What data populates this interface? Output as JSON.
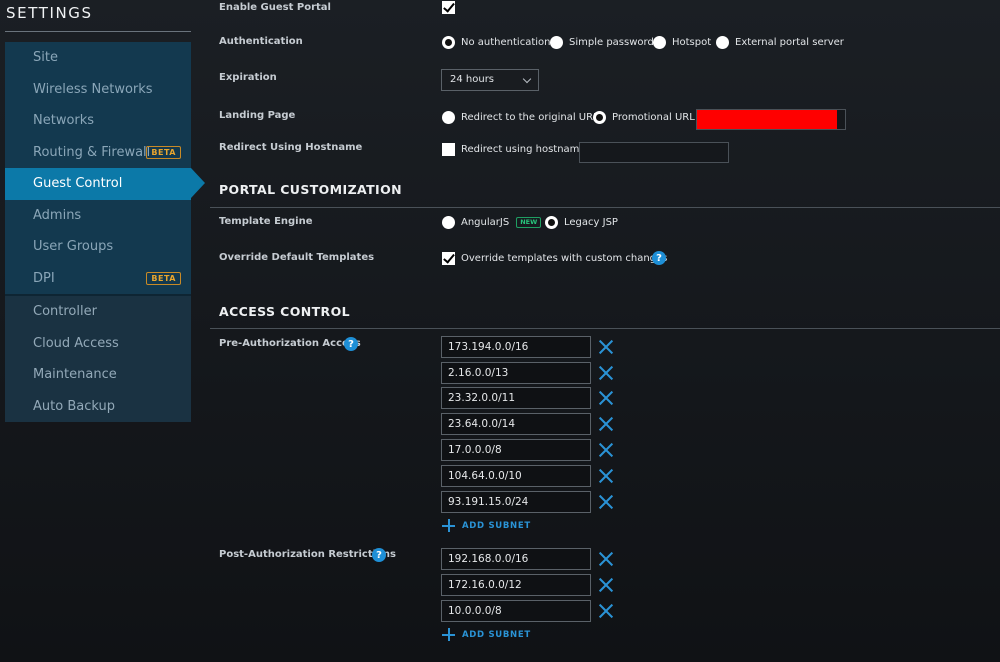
{
  "sidebar": {
    "title": "SETTINGS",
    "items": [
      {
        "label": "Site",
        "badge": "",
        "active": false,
        "group": 1
      },
      {
        "label": "Wireless Networks",
        "badge": "",
        "active": false,
        "group": 1
      },
      {
        "label": "Networks",
        "badge": "",
        "active": false,
        "group": 1
      },
      {
        "label": "Routing & Firewall",
        "badge": "BETA",
        "active": false,
        "group": 1
      },
      {
        "label": "Guest Control",
        "badge": "",
        "active": true,
        "group": 1
      },
      {
        "label": "Admins",
        "badge": "",
        "active": false,
        "group": 1
      },
      {
        "label": "User Groups",
        "badge": "",
        "active": false,
        "group": 1
      },
      {
        "label": "DPI",
        "badge": "BETA",
        "active": false,
        "group": 1
      },
      {
        "label": "Controller",
        "badge": "",
        "active": false,
        "group": 2
      },
      {
        "label": "Cloud Access",
        "badge": "",
        "active": false,
        "group": 2
      },
      {
        "label": "Maintenance",
        "badge": "",
        "active": false,
        "group": 2
      },
      {
        "label": "Auto Backup",
        "badge": "",
        "active": false,
        "group": 2
      }
    ]
  },
  "guest": {
    "enable_label": "Enable Guest Portal",
    "enable_checked": true,
    "auth_label": "Authentication",
    "auth_options": [
      "No authentication",
      "Simple password",
      "Hotspot",
      "External portal server"
    ],
    "auth_selected": 0,
    "expiration_label": "Expiration",
    "expiration_value": "24 hours",
    "landing_label": "Landing Page",
    "landing_options": [
      "Redirect to the original URL",
      "Promotional URL"
    ],
    "landing_selected": 1,
    "redirect_label": "Redirect Using Hostname",
    "redirect_option": "Redirect using hostname",
    "redirect_checked": false
  },
  "portal": {
    "title": "PORTAL CUSTOMIZATION",
    "engine_label": "Template Engine",
    "engine_options": [
      "AngularJS",
      "Legacy JSP"
    ],
    "engine_new_badge": "NEW",
    "engine_selected": 1,
    "override_label": "Override Default Templates",
    "override_option": "Override templates with custom changes",
    "override_checked": true
  },
  "access": {
    "title": "ACCESS CONTROL",
    "pre_label": "Pre-Authorization Access",
    "pre_subnets": [
      "173.194.0.0/16",
      "2.16.0.0/13",
      "23.32.0.0/11",
      "23.64.0.0/14",
      "17.0.0.0/8",
      "104.64.0.0/10",
      "93.191.15.0/24"
    ],
    "post_label": "Post-Authorization Restrictions",
    "post_subnets": [
      "192.168.0.0/16",
      "172.16.0.0/12",
      "10.0.0.0/8"
    ],
    "add_subnet_label": "ADD SUBNET",
    "help_glyph": "?"
  },
  "colors": {
    "accent": "#0c79a8",
    "link_blue": "#2a93d6",
    "beta_orange": "#e8a52e",
    "new_green": "#27c27a",
    "redaction": "#ff0000"
  }
}
